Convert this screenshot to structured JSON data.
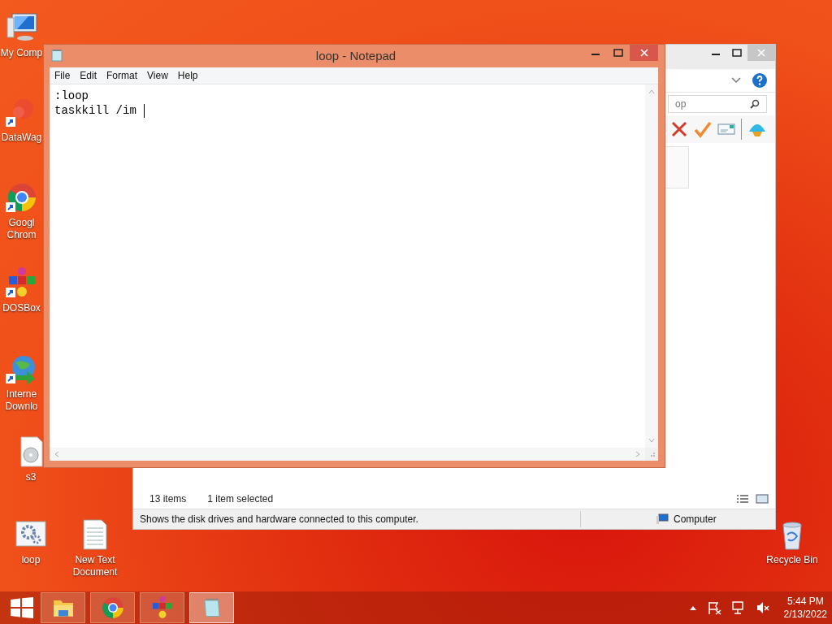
{
  "desktop_icons": [
    {
      "kind": "computer",
      "lines": [
        "My Comp"
      ],
      "shortcut": false
    },
    {
      "kind": "blob",
      "lines": [
        "DataWag"
      ],
      "shortcut": true
    },
    {
      "kind": "chrome",
      "lines": [
        "Googl",
        "Chrom"
      ],
      "shortcut": true
    },
    {
      "kind": "dosbox",
      "lines": [
        "DOSBox"
      ],
      "shortcut": true
    },
    {
      "kind": "globe",
      "lines": [
        "Interne",
        "Downlo"
      ],
      "shortcut": true
    },
    {
      "kind": "disc",
      "lines": [
        "s3"
      ],
      "shortcut": false
    },
    {
      "kind": "gears",
      "lines": [
        "loop"
      ],
      "shortcut": false
    },
    {
      "kind": "textfile",
      "lines": [
        "New Text",
        "Document"
      ],
      "shortcut": false
    },
    {
      "kind": "bin",
      "lines": [
        "Recycle Bin"
      ],
      "shortcut": false
    }
  ],
  "explorer": {
    "search": {
      "value": "op"
    },
    "item_count": "13 items",
    "selection": "1 item selected",
    "status_text": "Shows the disk drives and hardware connected to this computer.",
    "location": "Computer"
  },
  "notepad": {
    "title": "loop - Notepad",
    "menu": [
      "File",
      "Edit",
      "Format",
      "View",
      "Help"
    ],
    "lines": [
      ":loop",
      "taskkill /im"
    ]
  },
  "taskbar": {
    "buttons": [
      {
        "kind": "folder",
        "selected": false
      },
      {
        "kind": "chrome",
        "selected": false
      },
      {
        "kind": "dosbox",
        "selected": false
      },
      {
        "kind": "notepad",
        "selected": true
      }
    ],
    "clock": {
      "time": "5:44 PM",
      "date": "2/13/2022"
    }
  }
}
